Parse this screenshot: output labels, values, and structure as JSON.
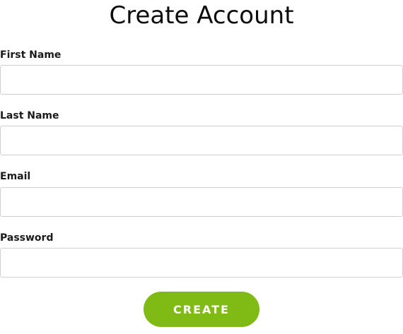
{
  "form": {
    "title": "Create Account",
    "fields": [
      {
        "label": "First Name",
        "value": "",
        "placeholder": ""
      },
      {
        "label": "Last Name",
        "value": "",
        "placeholder": ""
      },
      {
        "label": "Email",
        "value": "",
        "placeholder": ""
      },
      {
        "label": "Password",
        "value": "",
        "placeholder": ""
      }
    ],
    "submit_label": "CREATE"
  },
  "colors": {
    "button_bg": "#7fba15",
    "button_text": "#ffffff",
    "input_border": "#cfcfcf"
  }
}
